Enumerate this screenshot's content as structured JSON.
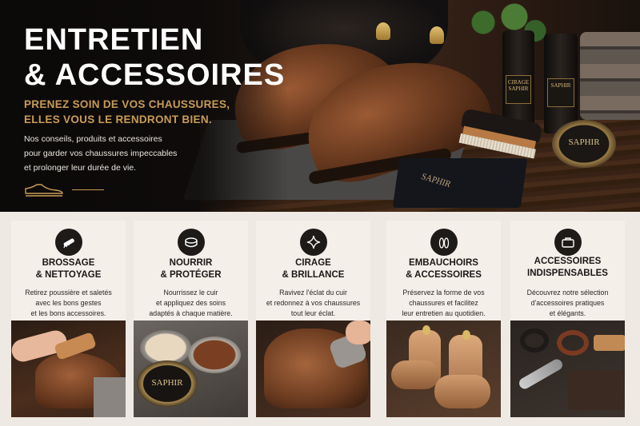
{
  "hero": {
    "title_line1": "ENTRETIEN",
    "title_line2": "& ACCESSOIRES",
    "subtitle_line1": "PRENEZ SOIN DE VOS CHAUSSURES,",
    "subtitle_line2": "ELLES VOUS LE RENDRONT BIEN.",
    "desc_line1": "Nos conseils, produits et accessoires",
    "desc_line2": "pour garder vos chaussures impeccables",
    "desc_line3": "et prolonger leur durée de vie.",
    "icon": "shoe-outline-icon",
    "bottle_label1": "CIRAGE",
    "bottle_label2": "SAPHIR",
    "tin_label": "SAPHIR",
    "cloth_label": "SAPHIR"
  },
  "colors": {
    "accent": "#c99b55",
    "dark": "#1d1a18",
    "card_bg": "#f4efe9",
    "page_bg": "#efe9e3"
  },
  "cards": [
    {
      "icon": "brush-icon",
      "title_line1": "BROSSAGE",
      "title_line2": "& NETTOYAGE",
      "desc_line1": "Retirez poussière et saletés",
      "desc_line2": "avec les bons gestes",
      "desc_line3": "et les bons accessoires."
    },
    {
      "icon": "polish-tin-icon",
      "title_line1": "NOURRIR",
      "title_line2": "& PROTÉGER",
      "desc_line1": "Nourrissez le cuir",
      "desc_line2": "et appliquez des soins",
      "desc_line3": "adaptés à chaque matière.",
      "tin_label": "SAPHIR"
    },
    {
      "icon": "sparkle-icon",
      "title_line1": "CIRAGE",
      "title_line2": "& BRILLANCE",
      "desc_line1": "Ravivez l'éclat du cuir",
      "desc_line2": "et redonnez à vos chaussures",
      "desc_line3": "tout leur éclat."
    },
    {
      "icon": "shoe-tree-icon",
      "title_line1": "EMBAUCHOIRS",
      "title_line2": "& ACCESSOIRES",
      "desc_line1": "Préservez la forme de vos",
      "desc_line2": "chaussures et facilitez",
      "desc_line3": "leur entretien au quotidien."
    },
    {
      "icon": "briefcase-icon",
      "title_line1": "ACCESSOIRES",
      "title_line2": "INDISPENSABLES",
      "desc_line1": "Découvrez notre sélection",
      "desc_line2": "d'accessoires pratiques",
      "desc_line3": "et élégants."
    }
  ]
}
